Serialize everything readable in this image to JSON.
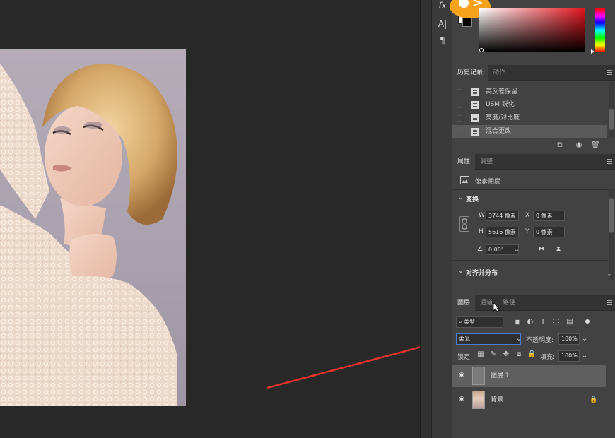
{
  "tools": {
    "fx": "fx",
    "text": "A|",
    "paragraph": "¶"
  },
  "history": {
    "tabs": [
      "历史记录",
      "动作"
    ],
    "active_tab": 0,
    "items": [
      {
        "label": "高反差保留",
        "selected": false
      },
      {
        "label": "USM 锐化",
        "selected": false
      },
      {
        "label": "亮度/对比度",
        "selected": false
      },
      {
        "label": "混合更改",
        "selected": true
      }
    ]
  },
  "properties": {
    "tabs": [
      "属性",
      "调整"
    ],
    "active_tab": 0,
    "type_label": "像素图层",
    "transform": {
      "title": "变换",
      "w_label": "W",
      "w_value": "3744 像素",
      "h_label": "H",
      "h_value": "5616 像素",
      "x_label": "X",
      "x_value": "0 像素",
      "y_label": "Y",
      "y_value": "0 像素",
      "angle_value": "0.00°"
    },
    "align_title": "对齐并分布"
  },
  "layers": {
    "tabs": [
      "图层",
      "通道",
      "路径"
    ],
    "active_tab": 0,
    "filter_kind": "类型",
    "blend_mode": "柔光",
    "opacity_label": "不透明度:",
    "opacity_value": "100%",
    "lock_label": "锁定:",
    "fill_label": "填充:",
    "fill_value": "100%",
    "items": [
      {
        "name": "图层 1",
        "selected": true
      },
      {
        "name": "背景",
        "selected": false,
        "locked": true
      }
    ]
  },
  "colors": {
    "accent_arrow": "#e8322e",
    "panel_bg": "#424242",
    "selected_row": "#5a5a5a"
  }
}
